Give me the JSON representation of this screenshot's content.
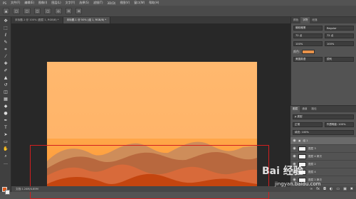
{
  "app": {
    "menu": [
      "PS",
      "文件(F)",
      "编辑(E)",
      "图像(I)",
      "图层(L)",
      "文字(Y)",
      "选择(S)",
      "滤镜(T)",
      "3D(D)",
      "视图(V)",
      "窗口(W)",
      "帮助(H)"
    ]
  },
  "options": [
    "▲",
    "□",
    "□",
    "□",
    "□",
    "◎",
    "⊟",
    "⊞"
  ],
  "tabs": [
    {
      "label": "未标题-1 @ 100% (图层 1, RGB/8) *",
      "active": false
    },
    {
      "label": "未标题-1 @ 50% (组 1, RGB/8) *",
      "active": true
    }
  ],
  "status": {
    "text": "文档:1.24M/4.85M"
  },
  "right_panel": {
    "tabs": [
      "颜色",
      "字符",
      "段落"
    ],
    "font_family": "微软雅黑",
    "font_style": "Regular",
    "font_size": "72 点",
    "leading": "72 点",
    "scale_v": "100%",
    "scale_h": "100%",
    "color_label": "颜色:",
    "lang": "美国英语",
    "aa": "锐利"
  },
  "layers_panel": {
    "tabs": [
      "图层",
      "通道",
      "路径"
    ],
    "filter": "ρ 类型",
    "blend": "正常",
    "opacity": "不透明度: 100%",
    "fill": "填充: 100%",
    "items": [
      {
        "name": "组 1",
        "selected": true
      },
      {
        "name": "图层 3",
        "selected": false
      },
      {
        "name": "图层 4 拷贝",
        "selected": false
      },
      {
        "name": "图层 2",
        "selected": false
      },
      {
        "name": "图层 4",
        "selected": false
      },
      {
        "name": "图层 2 拷贝",
        "selected": false
      },
      {
        "name": "图层 1",
        "selected": false
      }
    ]
  },
  "watermark": {
    "logo": "Bai 经验",
    "url": "jingyan.baidu.com"
  },
  "colors": {
    "canvas_top": "#ffb56a",
    "canvas_bottom": "#ff9a2e",
    "hill_dark": "#c4450f",
    "hill_mid": "#d86a3a",
    "hill_brown": "#b8683e",
    "red_box": "#d21f1f"
  }
}
